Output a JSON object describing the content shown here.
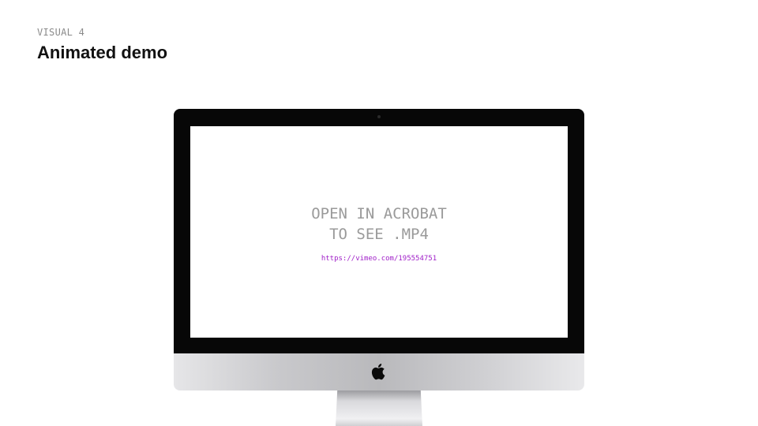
{
  "slide": {
    "eyebrow": "VISUAL 4",
    "title": "Animated demo"
  },
  "monitor": {
    "screen_line1": "OPEN IN ACROBAT",
    "screen_line2": "TO SEE .MP4",
    "link_text": "https://vimeo.com/195554751",
    "link_color": "#a020c8",
    "logo_icon": "apple-logo-icon"
  }
}
